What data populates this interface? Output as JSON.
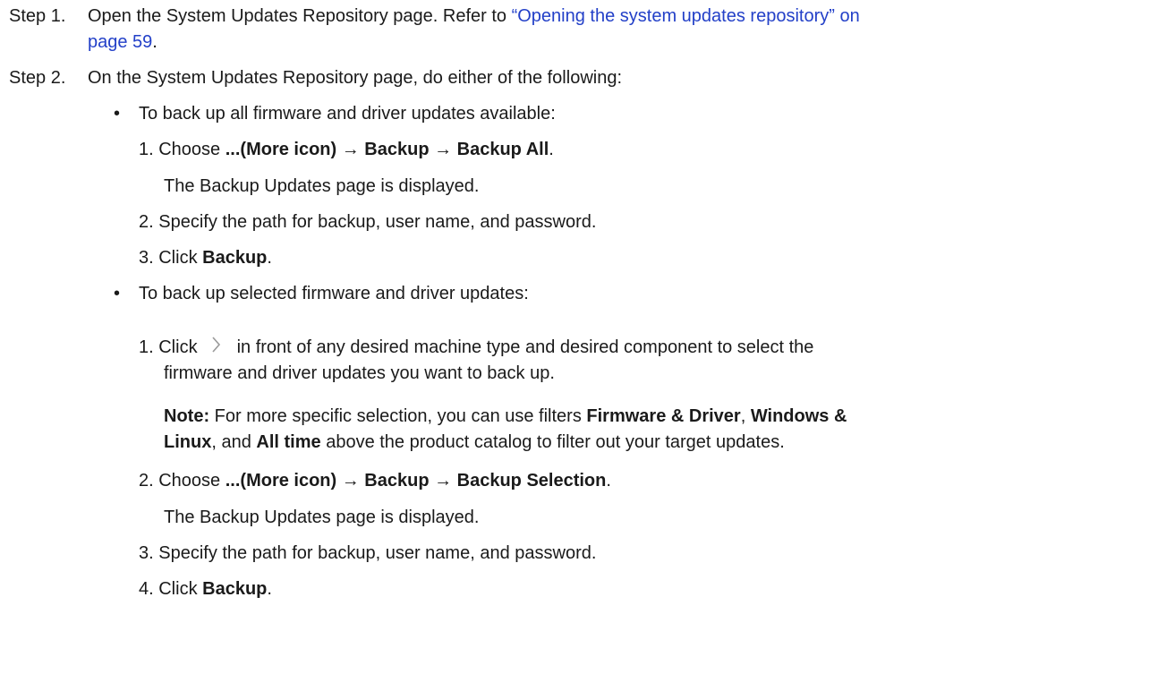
{
  "step1": {
    "label": "Step 1.",
    "text": "Open the System Updates Repository page. Refer to ",
    "link_line1": "“Opening the system updates repository” on",
    "link_line2": "page 59",
    "end": "."
  },
  "step2": {
    "label": "Step 2.",
    "text": "On the System Updates Repository page, do either of the following:"
  },
  "bullet_all": {
    "bullet": "•",
    "text": "To back up all firmware and driver updates available:",
    "item1": {
      "num": "1. Choose ",
      "bold": "...(More icon) → Backup → Backup All",
      "end": "."
    },
    "item1_result": "The Backup Updates page is displayed.",
    "item2": "2. Specify the path for backup, user name, and password.",
    "item3": {
      "num": "3. Click ",
      "bold": "Backup",
      "end": "."
    }
  },
  "bullet_sel": {
    "bullet": "•",
    "text": "To back up selected firmware and driver updates:",
    "item1": {
      "prefix": "1. Click",
      "icon": "chevron-right-icon",
      "text_line1": "in front of any desired machine type and desired component to select the",
      "text_line2": "firmware and driver updates you want to back up."
    },
    "note": {
      "label": "Note:",
      "t1": " For more specific selection, you can use filters ",
      "b1": "Firmware & Driver",
      "t2": ", ",
      "b2a": "Windows &",
      "b2b": "Linux",
      "t3": ", and ",
      "b3": "All time",
      "t4": " above the product catalog to filter out your target updates."
    },
    "item2": {
      "num": "2. Choose ",
      "bold": "...(More icon) → Backup → Backup Selection",
      "end": "."
    },
    "item2_result": "The Backup Updates page is displayed.",
    "item3": "3. Specify the path for backup, user name, and password.",
    "item4": {
      "num": "4. Click ",
      "bold": "Backup",
      "end": "."
    }
  }
}
